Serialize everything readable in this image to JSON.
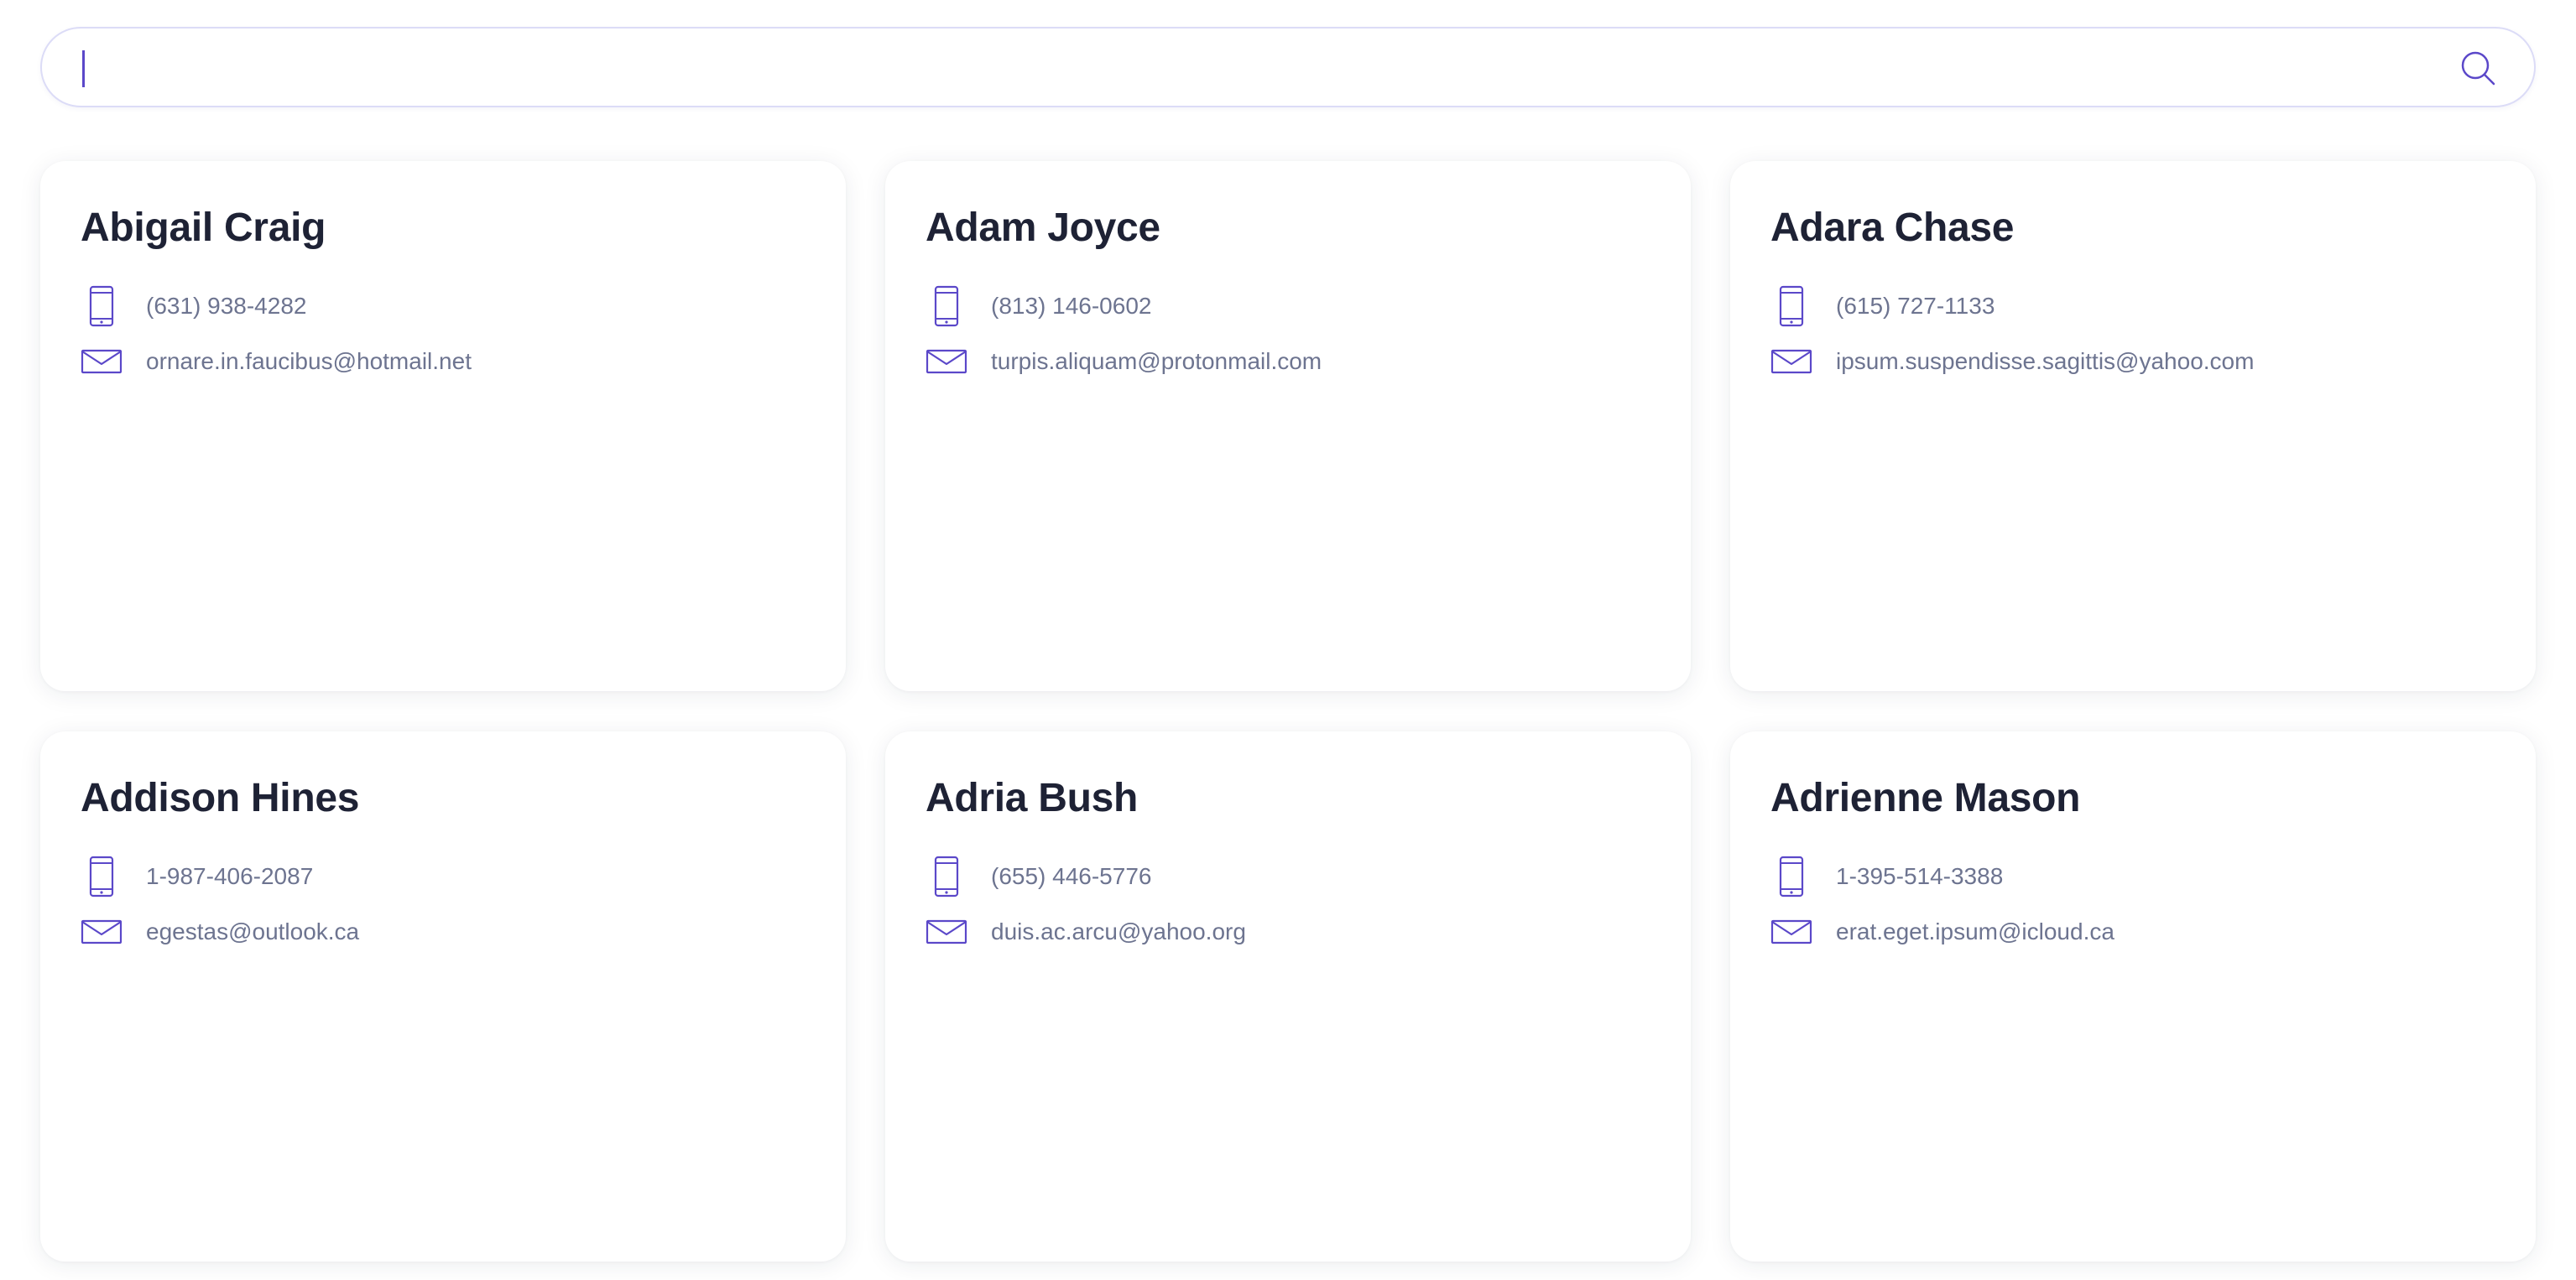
{
  "search": {
    "placeholder": "",
    "value": "",
    "icon": "search-icon"
  },
  "colors": {
    "accent": "#5b48c9",
    "name_text": "#1e2235",
    "detail_text": "#6d7490",
    "search_border": "#dcdcf7"
  },
  "contacts": [
    {
      "name": "Abigail Craig",
      "phone": "(631) 938-4282",
      "email": "ornare.in.faucibus@hotmail.net"
    },
    {
      "name": "Adam Joyce",
      "phone": "(813) 146-0602",
      "email": "turpis.aliquam@protonmail.com"
    },
    {
      "name": "Adara Chase",
      "phone": "(615) 727-1133",
      "email": "ipsum.suspendisse.sagittis@yahoo.com"
    },
    {
      "name": "Addison Hines",
      "phone": "1-987-406-2087",
      "email": "egestas@outlook.ca"
    },
    {
      "name": "Adria Bush",
      "phone": "(655) 446-5776",
      "email": "duis.ac.arcu@yahoo.org"
    },
    {
      "name": "Adrienne Mason",
      "phone": "1-395-514-3388",
      "email": "erat.eget.ipsum@icloud.ca"
    }
  ]
}
